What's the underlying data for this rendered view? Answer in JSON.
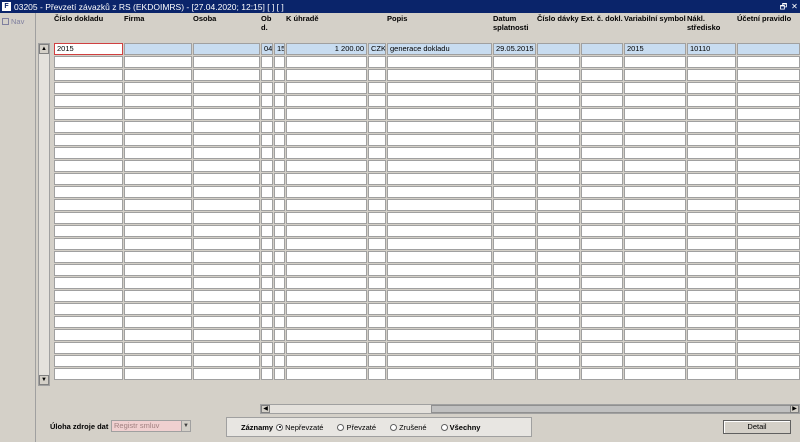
{
  "window": {
    "title": "03205 - Převzetí závazků z RS (EKDOIMRS) - [27.04.2020; 12:15]  [ ]  [ ]",
    "restore_glyph": "🗗",
    "close_glyph": "✕",
    "app_icon_glyph": "F"
  },
  "sidebar": {
    "items": [
      {
        "label": "Nav",
        "icon": "nav-icon"
      }
    ]
  },
  "columns": [
    {
      "key": "cislo",
      "label": "Číslo dokladu"
    },
    {
      "key": "firma",
      "label": "Firma"
    },
    {
      "key": "osoba",
      "label": "Osoba"
    },
    {
      "key": "obd",
      "label": "Ob d."
    },
    {
      "key": "obd2",
      "label": ""
    },
    {
      "key": "kuhrade",
      "label": "K úhradě"
    },
    {
      "key": "mena",
      "label": ""
    },
    {
      "key": "popis",
      "label": "Popis"
    },
    {
      "key": "datum",
      "label": "Datum splatnosti"
    },
    {
      "key": "davka",
      "label": "Číslo dávky"
    },
    {
      "key": "ext",
      "label": "Ext. č. dokl."
    },
    {
      "key": "vs",
      "label": "Variabilní symbol"
    },
    {
      "key": "stredisko",
      "label": "Nákl. středisko"
    },
    {
      "key": "pravidlo",
      "label": "Účetní pravidlo"
    }
  ],
  "rows": [
    {
      "cislo": "2015",
      "firma": "",
      "osoba": "",
      "obd": "04",
      "obd2": "15",
      "kuhrade": "1 200.00",
      "mena": "CZK",
      "popis": "generace dokladu",
      "datum": "29.05.2015",
      "davka": "",
      "ext": "",
      "vs": "2015",
      "stredisko": "10110",
      "pravidlo": ""
    }
  ],
  "empty_row_count": 25,
  "scroll": {
    "up": "▲",
    "down": "▼",
    "left": "◀",
    "right": "▶"
  },
  "footer": {
    "source_label": "Úloha zdroje dat",
    "source_value": "Registr smluv",
    "dropdown_glyph": "▼",
    "records_label": "Záznamy",
    "filters": [
      {
        "label": "Nepřevzaté",
        "selected": true
      },
      {
        "label": "Převzaté",
        "selected": false
      },
      {
        "label": "Zrušené",
        "selected": false
      },
      {
        "label": "Všechny",
        "selected": false
      }
    ],
    "detail_label": "Detail"
  }
}
